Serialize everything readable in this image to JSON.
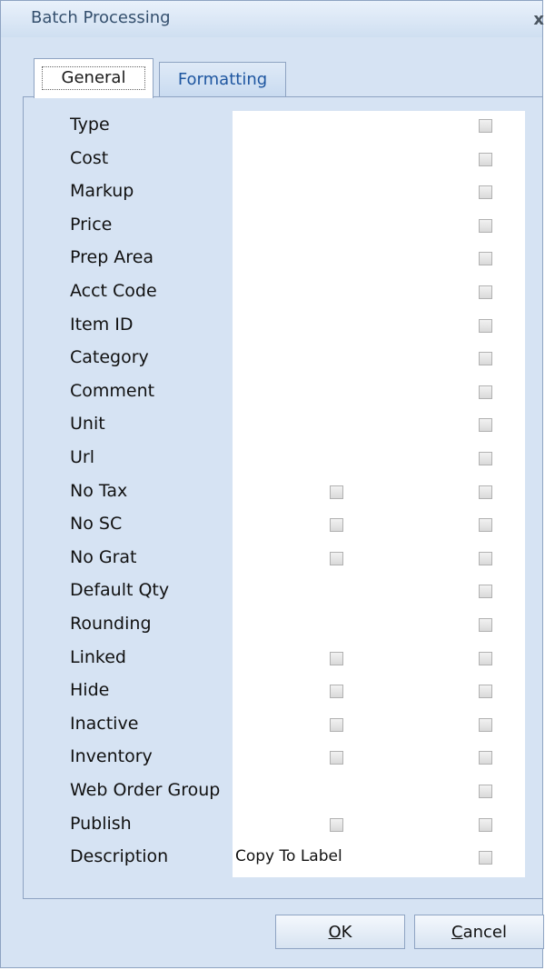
{
  "window": {
    "title": "Batch Processing",
    "close": "x"
  },
  "tabs": [
    {
      "label": "General",
      "selected": true
    },
    {
      "label": "Formatting",
      "selected": false
    }
  ],
  "rows": [
    {
      "label": "Type",
      "col1": false,
      "col2": true
    },
    {
      "label": "Cost",
      "col1": false,
      "col2": true
    },
    {
      "label": "Markup",
      "col1": false,
      "col2": true
    },
    {
      "label": "Price",
      "col1": false,
      "col2": true
    },
    {
      "label": "Prep Area",
      "col1": false,
      "col2": true
    },
    {
      "label": "Acct Code",
      "col1": false,
      "col2": true
    },
    {
      "label": "Item ID",
      "col1": false,
      "col2": true
    },
    {
      "label": "Category",
      "col1": false,
      "col2": true
    },
    {
      "label": "Comment",
      "col1": false,
      "col2": true
    },
    {
      "label": "Unit",
      "col1": false,
      "col2": true
    },
    {
      "label": "Url",
      "col1": false,
      "col2": true
    },
    {
      "label": "No Tax",
      "col1": true,
      "col2": true
    },
    {
      "label": "No SC",
      "col1": true,
      "col2": true
    },
    {
      "label": "No Grat",
      "col1": true,
      "col2": true
    },
    {
      "label": "Default Qty",
      "col1": false,
      "col2": true
    },
    {
      "label": "Rounding",
      "col1": false,
      "col2": true
    },
    {
      "label": "Linked",
      "col1": true,
      "col2": true
    },
    {
      "label": "Hide",
      "col1": true,
      "col2": true
    },
    {
      "label": "Inactive",
      "col1": true,
      "col2": true
    },
    {
      "label": "Inventory",
      "col1": true,
      "col2": true
    },
    {
      "label": "Web Order Group",
      "col1": false,
      "col2": true
    },
    {
      "label": "Publish",
      "col1": true,
      "col2": true
    },
    {
      "label": "Description",
      "col1": false,
      "col2": true,
      "extra": "Copy To Label"
    }
  ],
  "buttons": {
    "ok": "OK",
    "ok_mnemonic": "O",
    "ok_rest": "K",
    "cancel": "Cancel",
    "cancel_mnemonic": "C",
    "cancel_rest": "ancel"
  }
}
